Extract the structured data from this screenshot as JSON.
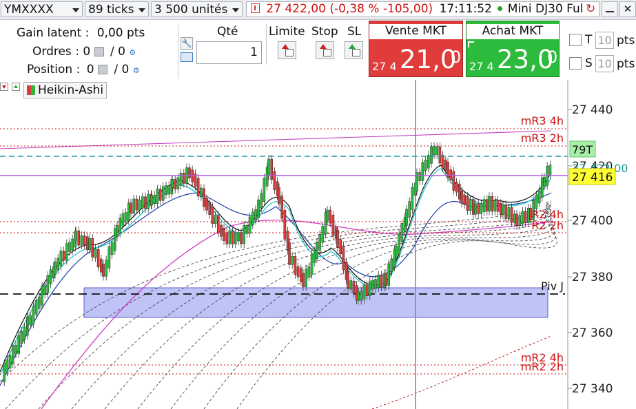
{
  "toolbar": {
    "instrument": "YMXXXX",
    "ticks": "89 ticks",
    "units": "3 500 unités",
    "quote_price": "27 422,00 (-0,38 % -105,00)",
    "time": "17:11:52",
    "instrument_name": "Mini DJ30 Ful",
    "colors": {
      "negative": "#d01010",
      "connected_dot": "#2aa02a"
    }
  },
  "positions": {
    "gain_label": "Gain latent :",
    "gain_value": "0,00 pts",
    "orders_label": "Ordres :",
    "orders_value": "0",
    "orders_sep": "/ 0",
    "position_label": "Position :",
    "position_value": "0",
    "position_sep": "/ 0"
  },
  "order_entry": {
    "qty_label": "Qté",
    "qty_value": "1",
    "limit_label": "Limite",
    "stop_label": "Stop",
    "sl_label": "SL",
    "sell": {
      "label": "Vente MKT",
      "price_prefix": "27 4",
      "price_main": "21,0",
      "price_sup": "0",
      "color": "#e03c3c"
    },
    "buy": {
      "label": "Achat MKT",
      "price_prefix": "27 4",
      "price_main": "23,0",
      "price_sup": "0",
      "color": "#2cbb3c"
    },
    "t_label": "T",
    "t_value": "10",
    "s_label": "S",
    "s_value": "10",
    "pts_label": "pts"
  },
  "chart": {
    "style_label": "Heikin-Ashi",
    "price_axis": [
      "27 440",
      "27 420",
      "27 400",
      "27 380",
      "27 360",
      "27 340"
    ],
    "current_price_tag": "27 416",
    "tick_count_tag": "79T",
    "hidden_price_tag": "27 422,00",
    "levels": {
      "mR3_4h": "mR3 4h",
      "mR3_2h": "mR3 2h",
      "R2_4h": "R2 4h",
      "R2_2h": "R2 2h",
      "piv_j": "Piv J",
      "mR2_4h": "mR2 4h",
      "mR2_2h": "mR2 2h"
    },
    "colors": {
      "bull": "#2db83d",
      "bear": "#d83c3c",
      "level": "#cc1111",
      "zone": "#aab0f0",
      "purple": "#a845d6",
      "teal": "#1a9a9a"
    }
  }
}
